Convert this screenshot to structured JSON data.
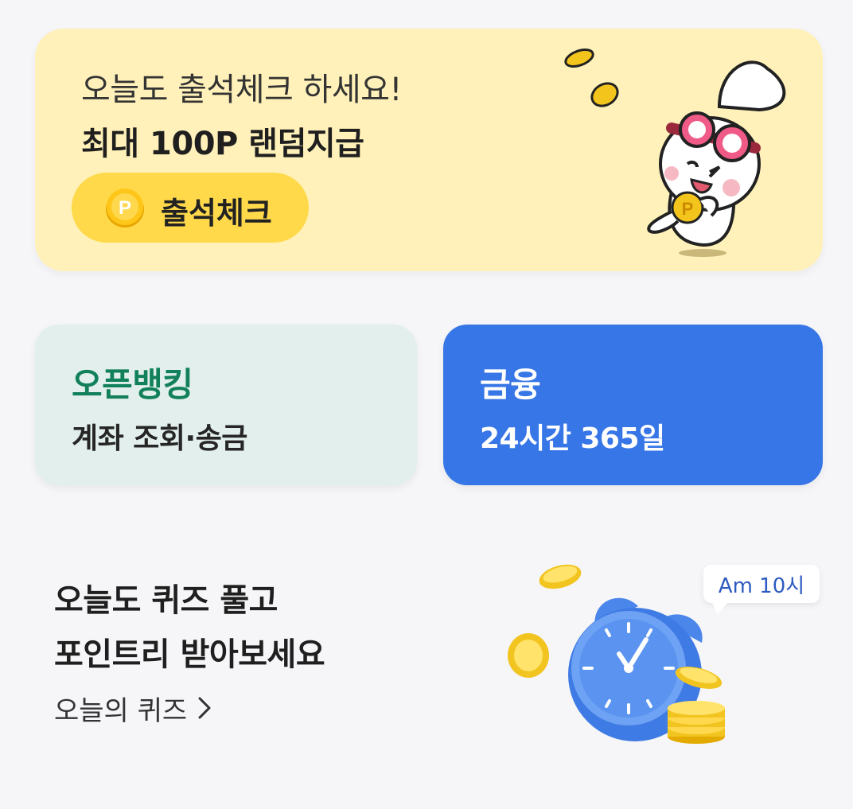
{
  "attendance": {
    "line1": "오늘도 출석체크 하세요!",
    "line2": "최대 100P 랜덤지급",
    "button_label": "출석체크",
    "coin_letter": "P",
    "mascot": "rabbit-with-goggles-holding-coin",
    "colors": {
      "card": "#fff1b9",
      "button": "#ffd94a"
    }
  },
  "open_banking": {
    "title": "오픈뱅킹",
    "subtitle": "계좌 조회·송금",
    "colors": {
      "card": "#e2efec",
      "title": "#12805a"
    }
  },
  "finance": {
    "title": "금융",
    "subtitle": "24시간 365일",
    "colors": {
      "card": "#3776e6",
      "text": "#ffffff"
    }
  },
  "quiz": {
    "line1": "오늘도 퀴즈 풀고",
    "line2": "포인트리 받아보세요",
    "link_label": "오늘의 퀴즈",
    "time_badge": "Am 10시",
    "illustration": "alarm-clock-with-coins"
  }
}
